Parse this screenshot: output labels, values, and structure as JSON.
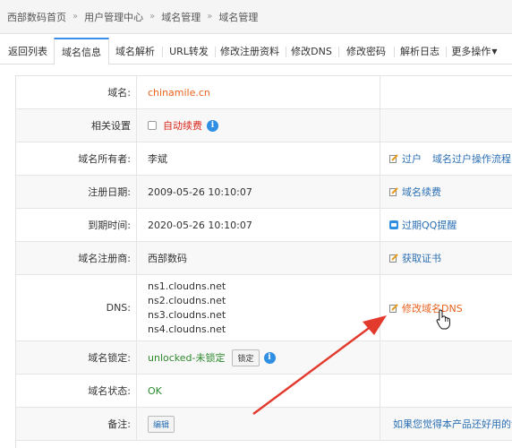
{
  "breadcrumb": [
    "西部数码首页",
    "用户管理中心",
    "域名管理",
    "域名管理"
  ],
  "tabs": [
    {
      "label": "返回列表",
      "active": false
    },
    {
      "label": "域名信息",
      "active": true
    },
    {
      "label": "域名解析",
      "active": false
    },
    {
      "label": "URL转发",
      "active": false
    },
    {
      "label": "修改注册资料",
      "active": false
    },
    {
      "label": "修改DNS",
      "active": false
    },
    {
      "label": "修改密码",
      "active": false
    },
    {
      "label": "解析日志",
      "active": false
    },
    {
      "label": "更多操作",
      "active": false,
      "dropdown": true
    }
  ],
  "rows": {
    "domain": {
      "label": "域名:",
      "value": "chinamile.cn"
    },
    "settings": {
      "label": "相关设置",
      "checkbox_label": "自动续费"
    },
    "owner": {
      "label": "域名所有者:",
      "value": "李斌",
      "action1": "过户",
      "action2": "域名过户操作流程"
    },
    "register_date": {
      "label": "注册日期:",
      "value": "2009-05-26 10:10:07",
      "action": "域名续费"
    },
    "expire_date": {
      "label": "到期时间:",
      "value": "2020-05-26 10:10:07",
      "action": "过期QQ提醒"
    },
    "registrar": {
      "label": "域名注册商:",
      "value": "西部数码",
      "action": "获取证书"
    },
    "dns": {
      "label": "DNS:",
      "servers": [
        "ns1.cloudns.net",
        "ns2.cloudns.net",
        "ns3.cloudns.net",
        "ns4.cloudns.net"
      ],
      "action": "修改域名DNS"
    },
    "lock": {
      "label": "域名锁定:",
      "value": "unlocked-未锁定",
      "button": "锁定"
    },
    "status": {
      "label": "域名状态:",
      "value": "OK"
    },
    "note": {
      "label": "备注:",
      "button": "编辑",
      "action": "如果您觉得本产品还好用的话"
    }
  },
  "colors": {
    "accent": "#e8611d",
    "link": "#2a6fb3",
    "arrow": "#e23b2e",
    "tab_active": "#3a8ee6"
  }
}
